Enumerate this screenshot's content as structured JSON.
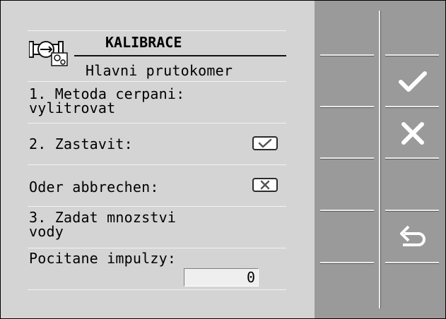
{
  "header": {
    "title": "KALIBRACE",
    "subtitle": "Hlavni prutokomer",
    "icon": "flowmeter-calibration-icon"
  },
  "rows": [
    {
      "line1": "1. Metoda cerpani:",
      "line2": "vylitrovat"
    },
    {
      "line1": "2. Zastavit:",
      "toggle": "check-icon"
    },
    {
      "line1": "Oder abbrechen:",
      "toggle": "close-icon"
    },
    {
      "line1": "3. Zadat mnozstvi",
      "line2": "vody"
    },
    {
      "line1": "Pocitane impulzy:",
      "value": "0"
    }
  ],
  "softkeys": {
    "confirm": "check-icon",
    "cancel": "close-icon",
    "back": "back-arrow-icon"
  },
  "colors": {
    "panel": "#d4d4d4",
    "softkey_bar": "#9a9a9a",
    "icon": "#ffffff"
  }
}
